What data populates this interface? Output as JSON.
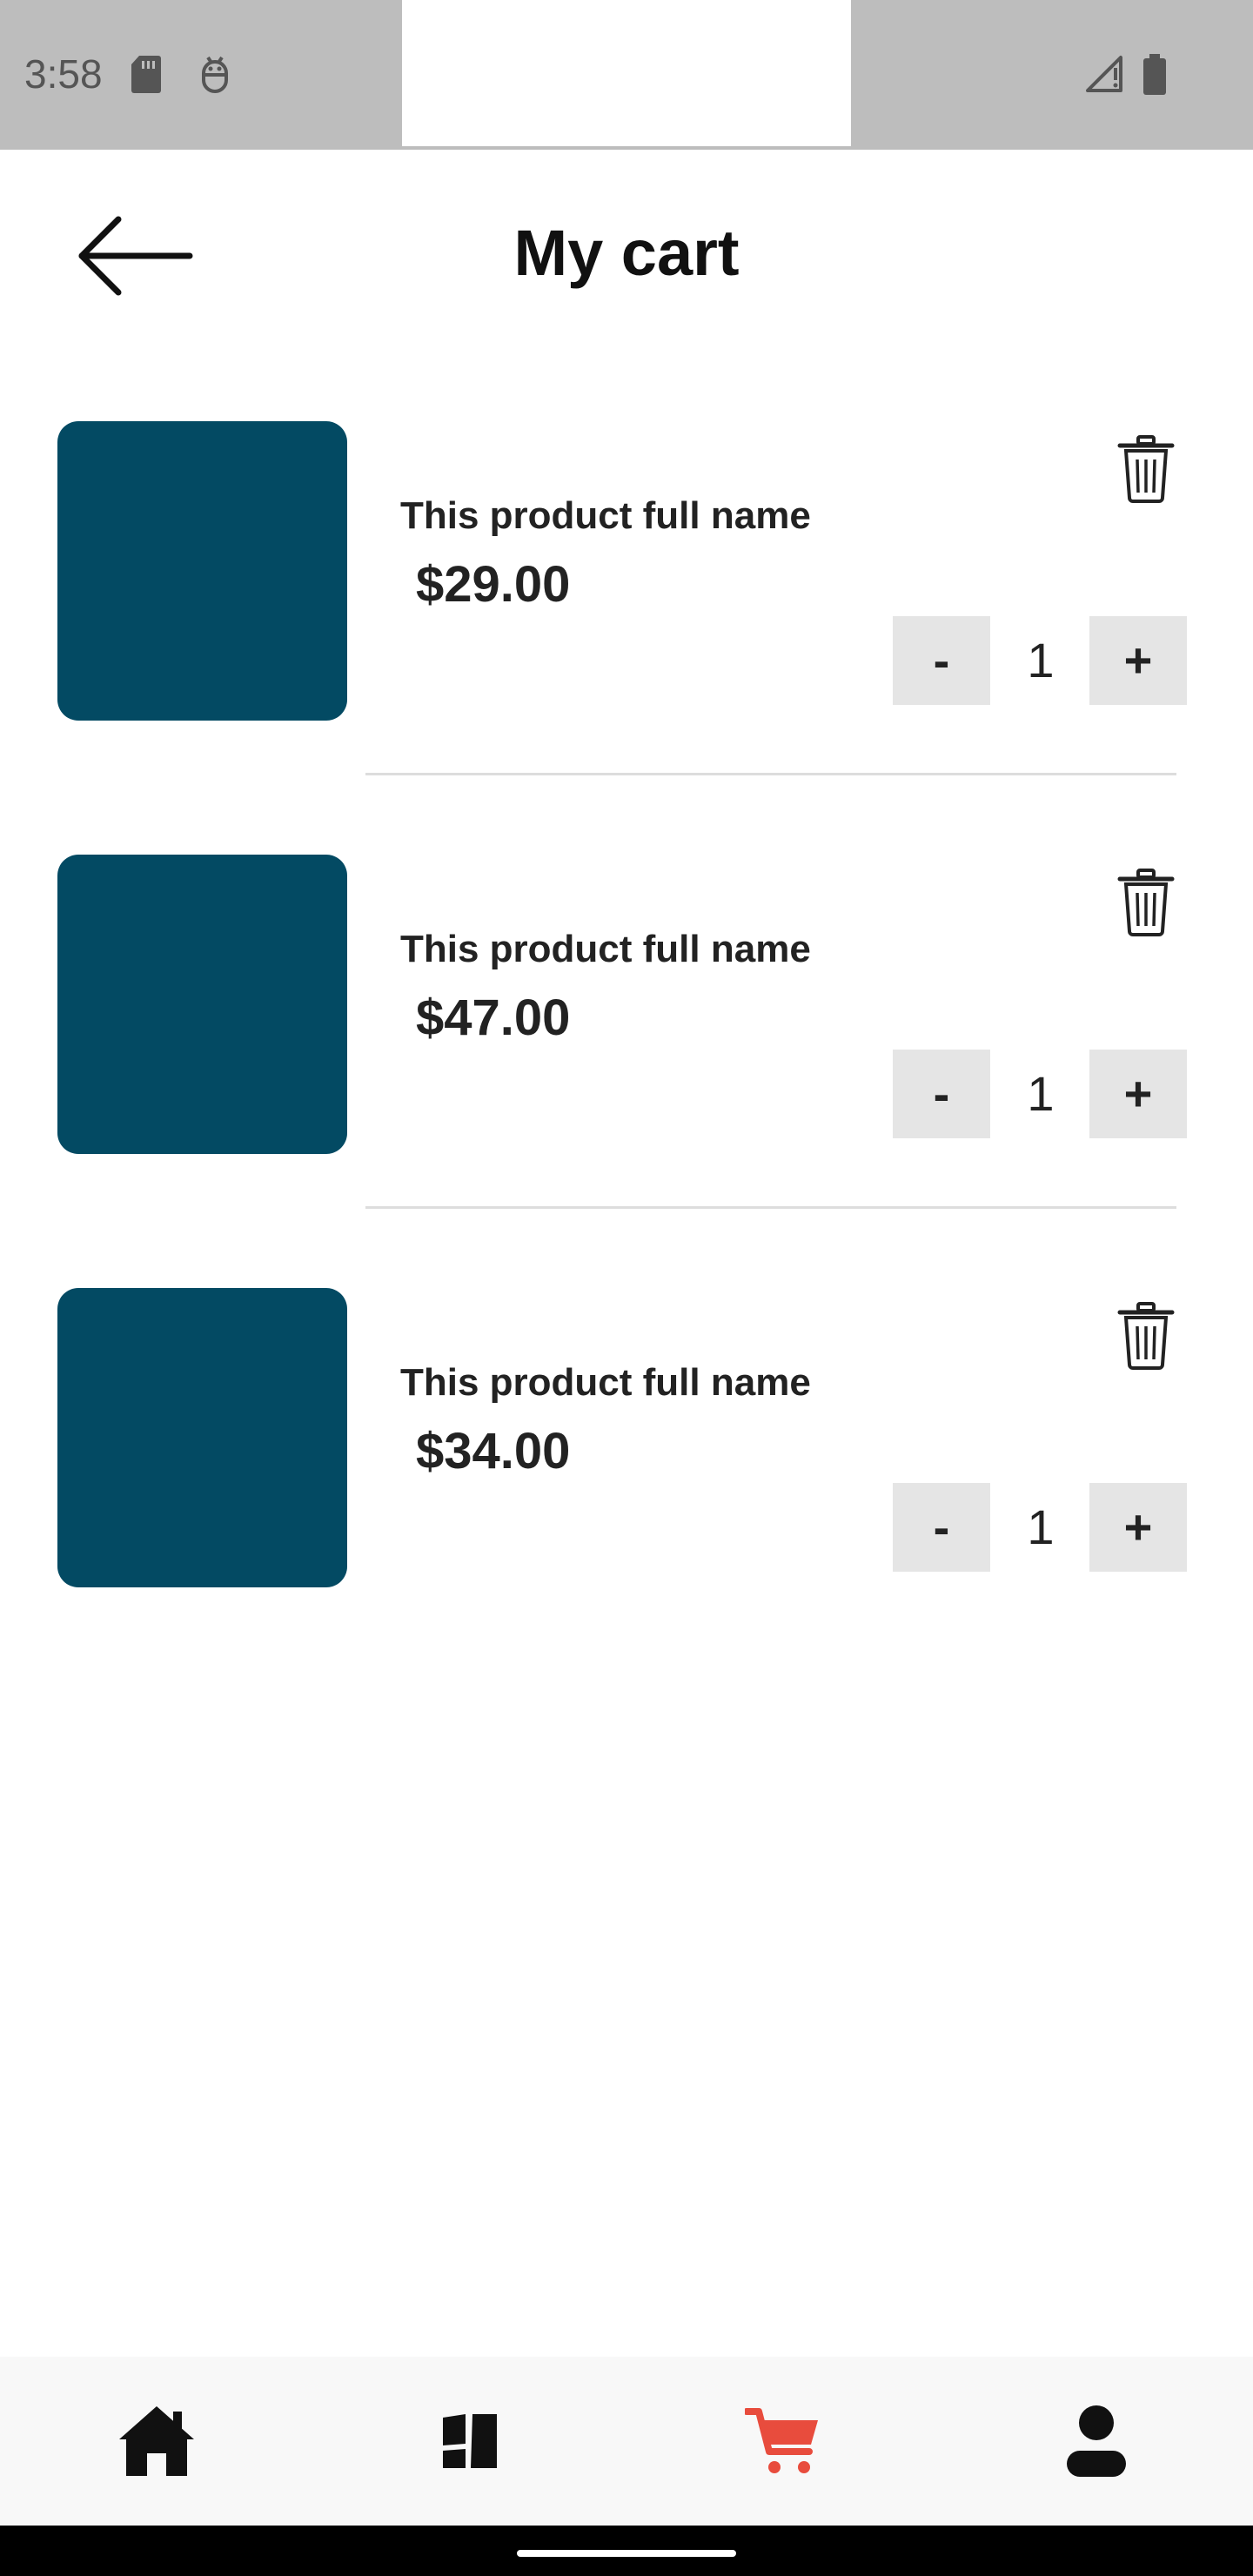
{
  "status_bar": {
    "time": "3:58"
  },
  "header": {
    "title": "My cart"
  },
  "cart": {
    "items": [
      {
        "name": "This product full name",
        "price": "$29.00",
        "quantity": "1",
        "minus_label": "-",
        "plus_label": "+"
      },
      {
        "name": "This product full name",
        "price": "$47.00",
        "quantity": "1",
        "minus_label": "-",
        "plus_label": "+"
      },
      {
        "name": "This product full name",
        "price": "$34.00",
        "quantity": "1",
        "minus_label": "-",
        "plus_label": "+"
      }
    ]
  },
  "bottom_nav": {
    "items": [
      {
        "icon": "home-icon",
        "active": false
      },
      {
        "icon": "categories-icon",
        "active": false
      },
      {
        "icon": "cart-icon",
        "active": true
      },
      {
        "icon": "profile-icon",
        "active": false
      }
    ],
    "active_color": "#e84c3d",
    "inactive_color": "#111111"
  },
  "colors": {
    "product_placeholder": "#034a63",
    "quantity_button_bg": "#e5e5e5",
    "status_bar_bg": "#bdbdbd"
  }
}
